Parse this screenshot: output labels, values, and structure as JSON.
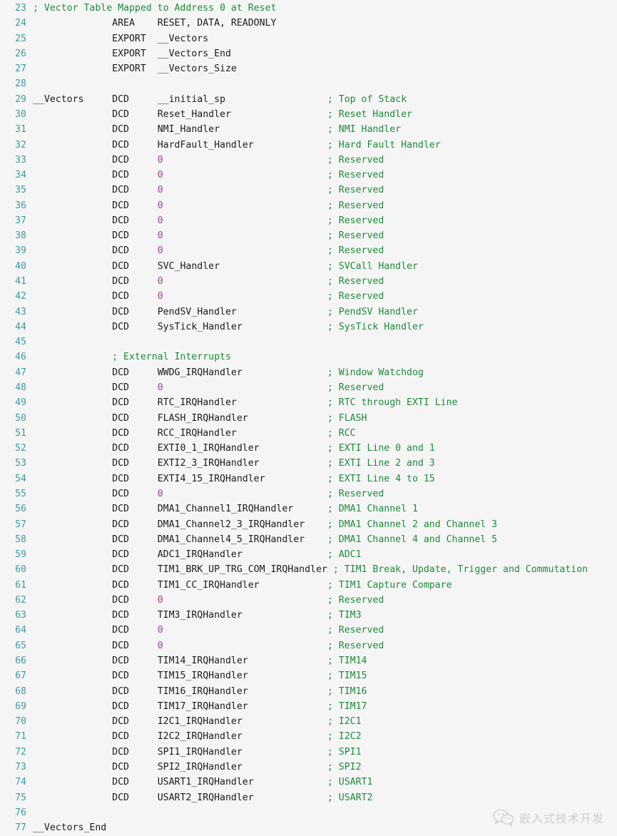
{
  "editor": {
    "background_color": "#f5f5f5",
    "linenumber_color": "#3d9aa5",
    "text_color": "#1c1c1c",
    "comment_color": "#1f8a3b",
    "number_color": "#9b3f9b",
    "first_line_number": 23,
    "last_line_number": 77
  },
  "watermark": {
    "icon": "wechat-icon",
    "text": "嵌入式技术开发"
  },
  "lines": [
    {
      "num": "23",
      "label": "",
      "directive": "",
      "operand": "",
      "comment": "; Vector Table Mapped to Address 0 at Reset",
      "comment_col": 0,
      "whole_comment": true
    },
    {
      "num": "24",
      "label": "",
      "directive": "AREA",
      "operand": "RESET, DATA, READONLY",
      "comment": ""
    },
    {
      "num": "25",
      "label": "",
      "directive": "EXPORT",
      "operand": "__Vectors",
      "comment": ""
    },
    {
      "num": "26",
      "label": "",
      "directive": "EXPORT",
      "operand": "__Vectors_End",
      "comment": ""
    },
    {
      "num": "27",
      "label": "",
      "directive": "EXPORT",
      "operand": "__Vectors_Size",
      "comment": ""
    },
    {
      "num": "28",
      "label": "",
      "directive": "",
      "operand": "",
      "comment": ""
    },
    {
      "num": "29",
      "label": "__Vectors",
      "directive": "DCD",
      "operand": "__initial_sp",
      "comment": "; Top of Stack"
    },
    {
      "num": "30",
      "label": "",
      "directive": "DCD",
      "operand": "Reset_Handler",
      "comment": "; Reset Handler"
    },
    {
      "num": "31",
      "label": "",
      "directive": "DCD",
      "operand": "NMI_Handler",
      "comment": "; NMI Handler"
    },
    {
      "num": "32",
      "label": "",
      "directive": "DCD",
      "operand": "HardFault_Handler",
      "comment": "; Hard Fault Handler"
    },
    {
      "num": "33",
      "label": "",
      "directive": "DCD",
      "operand": "0",
      "operand_is_number": true,
      "comment": "; Reserved"
    },
    {
      "num": "34",
      "label": "",
      "directive": "DCD",
      "operand": "0",
      "operand_is_number": true,
      "comment": "; Reserved"
    },
    {
      "num": "35",
      "label": "",
      "directive": "DCD",
      "operand": "0",
      "operand_is_number": true,
      "comment": "; Reserved"
    },
    {
      "num": "36",
      "label": "",
      "directive": "DCD",
      "operand": "0",
      "operand_is_number": true,
      "comment": "; Reserved"
    },
    {
      "num": "37",
      "label": "",
      "directive": "DCD",
      "operand": "0",
      "operand_is_number": true,
      "comment": "; Reserved"
    },
    {
      "num": "38",
      "label": "",
      "directive": "DCD",
      "operand": "0",
      "operand_is_number": true,
      "comment": "; Reserved"
    },
    {
      "num": "39",
      "label": "",
      "directive": "DCD",
      "operand": "0",
      "operand_is_number": true,
      "comment": "; Reserved"
    },
    {
      "num": "40",
      "label": "",
      "directive": "DCD",
      "operand": "SVC_Handler",
      "comment": "; SVCall Handler"
    },
    {
      "num": "41",
      "label": "",
      "directive": "DCD",
      "operand": "0",
      "operand_is_number": true,
      "comment": "; Reserved"
    },
    {
      "num": "42",
      "label": "",
      "directive": "DCD",
      "operand": "0",
      "operand_is_number": true,
      "comment": "; Reserved"
    },
    {
      "num": "43",
      "label": "",
      "directive": "DCD",
      "operand": "PendSV_Handler",
      "comment": "; PendSV Handler"
    },
    {
      "num": "44",
      "label": "",
      "directive": "DCD",
      "operand": "SysTick_Handler",
      "comment": "; SysTick Handler"
    },
    {
      "num": "45",
      "label": "",
      "directive": "",
      "operand": "",
      "comment": ""
    },
    {
      "num": "46",
      "label": "",
      "directive": "",
      "operand": "",
      "comment": "; External Interrupts",
      "comment_col": 14,
      "whole_comment": true
    },
    {
      "num": "47",
      "label": "",
      "directive": "DCD",
      "operand": "WWDG_IRQHandler",
      "comment": "; Window Watchdog"
    },
    {
      "num": "48",
      "label": "",
      "directive": "DCD",
      "operand": "0",
      "operand_is_number": true,
      "comment": "; Reserved"
    },
    {
      "num": "49",
      "label": "",
      "directive": "DCD",
      "operand": "RTC_IRQHandler",
      "comment": "; RTC through EXTI Line"
    },
    {
      "num": "50",
      "label": "",
      "directive": "DCD",
      "operand": "FLASH_IRQHandler",
      "comment": "; FLASH"
    },
    {
      "num": "51",
      "label": "",
      "directive": "DCD",
      "operand": "RCC_IRQHandler",
      "comment": "; RCC"
    },
    {
      "num": "52",
      "label": "",
      "directive": "DCD",
      "operand": "EXTI0_1_IRQHandler",
      "comment": "; EXTI Line 0 and 1"
    },
    {
      "num": "53",
      "label": "",
      "directive": "DCD",
      "operand": "EXTI2_3_IRQHandler",
      "comment": "; EXTI Line 2 and 3"
    },
    {
      "num": "54",
      "label": "",
      "directive": "DCD",
      "operand": "EXTI4_15_IRQHandler",
      "comment": "; EXTI Line 4 to 15"
    },
    {
      "num": "55",
      "label": "",
      "directive": "DCD",
      "operand": "0",
      "operand_is_number": true,
      "comment": "; Reserved"
    },
    {
      "num": "56",
      "label": "",
      "directive": "DCD",
      "operand": "DMA1_Channel1_IRQHandler",
      "comment": "; DMA1 Channel 1"
    },
    {
      "num": "57",
      "label": "",
      "directive": "DCD",
      "operand": "DMA1_Channel2_3_IRQHandler",
      "comment": "; DMA1 Channel 2 and Channel 3"
    },
    {
      "num": "58",
      "label": "",
      "directive": "DCD",
      "operand": "DMA1_Channel4_5_IRQHandler",
      "comment": "; DMA1 Channel 4 and Channel 5"
    },
    {
      "num": "59",
      "label": "",
      "directive": "DCD",
      "operand": "ADC1_IRQHandler",
      "comment": "; ADC1"
    },
    {
      "num": "60",
      "label": "",
      "directive": "DCD",
      "operand": "TIM1_BRK_UP_TRG_COM_IRQHandler",
      "comment": "; TIM1 Break, Update, Trigger and Commutation",
      "clipped": true
    },
    {
      "num": "61",
      "label": "",
      "directive": "DCD",
      "operand": "TIM1_CC_IRQHandler",
      "comment": "; TIM1 Capture Compare"
    },
    {
      "num": "62",
      "label": "",
      "directive": "DCD",
      "operand": "0",
      "operand_is_number": true,
      "comment": "; Reserved"
    },
    {
      "num": "63",
      "label": "",
      "directive": "DCD",
      "operand": "TIM3_IRQHandler",
      "comment": "; TIM3"
    },
    {
      "num": "64",
      "label": "",
      "directive": "DCD",
      "operand": "0",
      "operand_is_number": true,
      "comment": "; Reserved"
    },
    {
      "num": "65",
      "label": "",
      "directive": "DCD",
      "operand": "0",
      "operand_is_number": true,
      "comment": "; Reserved"
    },
    {
      "num": "66",
      "label": "",
      "directive": "DCD",
      "operand": "TIM14_IRQHandler",
      "comment": "; TIM14"
    },
    {
      "num": "67",
      "label": "",
      "directive": "DCD",
      "operand": "TIM15_IRQHandler",
      "comment": "; TIM15"
    },
    {
      "num": "68",
      "label": "",
      "directive": "DCD",
      "operand": "TIM16_IRQHandler",
      "comment": "; TIM16"
    },
    {
      "num": "69",
      "label": "",
      "directive": "DCD",
      "operand": "TIM17_IRQHandler",
      "comment": "; TIM17"
    },
    {
      "num": "70",
      "label": "",
      "directive": "DCD",
      "operand": "I2C1_IRQHandler",
      "comment": "; I2C1"
    },
    {
      "num": "71",
      "label": "",
      "directive": "DCD",
      "operand": "I2C2_IRQHandler",
      "comment": "; I2C2"
    },
    {
      "num": "72",
      "label": "",
      "directive": "DCD",
      "operand": "SPI1_IRQHandler",
      "comment": "; SPI1"
    },
    {
      "num": "73",
      "label": "",
      "directive": "DCD",
      "operand": "SPI2_IRQHandler",
      "comment": "; SPI2"
    },
    {
      "num": "74",
      "label": "",
      "directive": "DCD",
      "operand": "USART1_IRQHandler",
      "comment": "; USART1"
    },
    {
      "num": "75",
      "label": "",
      "directive": "DCD",
      "operand": "USART2_IRQHandler",
      "comment": "; USART2"
    },
    {
      "num": "76",
      "label": "",
      "directive": "",
      "operand": "",
      "comment": ""
    },
    {
      "num": "77",
      "label": "__Vectors_End",
      "directive": "",
      "operand": "",
      "comment": ""
    }
  ]
}
